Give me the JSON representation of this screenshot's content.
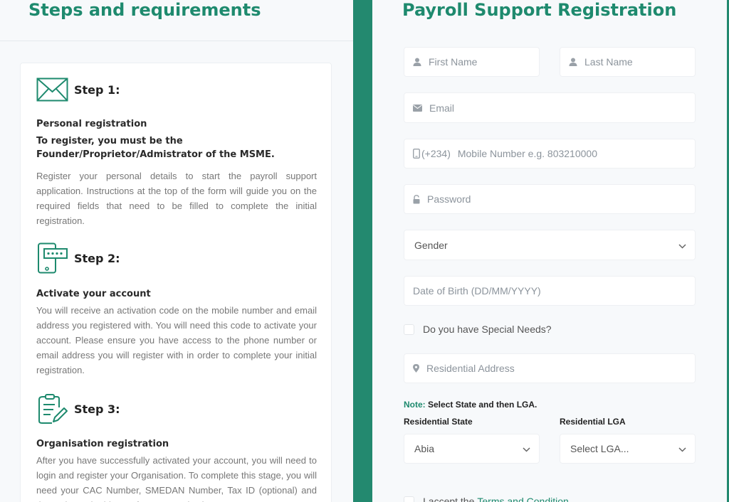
{
  "left": {
    "title": "Steps and requirements",
    "steps": [
      {
        "label": "Step 1:",
        "icon": "envelope-icon",
        "subtitle": "Personal registration",
        "subtitle2": "To register, you must be the Founder/Proprietor/Admistrator of the MSME.",
        "body": "Register your personal details to start the payroll support application. Instructions at the top of the form will guide you on the required fields that need to be filled to complete the initial registration."
      },
      {
        "label": "Step 2:",
        "icon": "mobile-code-icon",
        "subtitle": "Activate your account",
        "body": "You will receive an activation code on the mobile number and email address you registered with. You will need this code to activate your account. Please ensure you have access to the phone number or email address you will register with in order to complete your initial registration."
      },
      {
        "label": "Step 3:",
        "icon": "clipboard-edit-icon",
        "subtitle": "Organisation registration",
        "body": "After you have successfully activated your account, you will need to login and register your Organisation. To complete this stage, you will need your CAC Number, SMEDAN Number, Tax ID (optional) and the registered address of your Organisation."
      }
    ]
  },
  "form": {
    "title": "Payroll Support Registration",
    "first_name_placeholder": "First Name",
    "last_name_placeholder": "Last Name",
    "email_placeholder": "Email",
    "phone_prefix": "(+234)",
    "phone_placeholder": "Mobile Number e.g. 803210000",
    "password_placeholder": "Password",
    "gender_value": "Gender",
    "dob_placeholder": "Date of Birth (DD/MM/YYYY)",
    "special_needs_label": "Do you have Special Needs?",
    "address_placeholder": "Residential Address",
    "note_label": "Note:",
    "note_text": " Select State and then LGA.",
    "state_label": "Residential State",
    "state_value": "Abia",
    "lga_label": "Residential LGA",
    "lga_value": "Select LGA...",
    "terms_text": "I accept the",
    "terms_link": "Terms and Condition"
  },
  "colors": {
    "brand_green": "#23896f",
    "title_green": "#1e8a6e"
  }
}
